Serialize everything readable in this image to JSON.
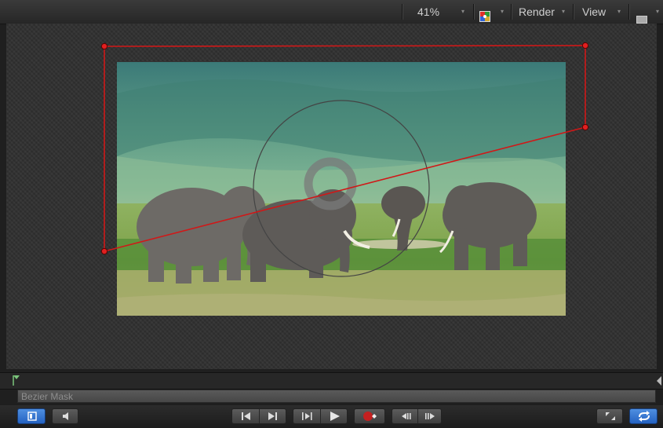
{
  "toolbar": {
    "zoom_level": "41%",
    "render_label": "Render",
    "view_label": "View",
    "dropdown_arrow": "▾",
    "icons": [
      "color-channel-icon",
      "layout-icon"
    ]
  },
  "canvas": {
    "image_subject": "elephants-on-savanna",
    "mask_color": "#d01818",
    "onscreen_controls": [
      "bezier-mask-handles",
      "center-target-ring"
    ]
  },
  "timeline": {
    "playhead_icon": "playhead-marker-icon",
    "end_marker_icon": "out-point-icon",
    "track_label": "Bezier Mask"
  },
  "transport": {
    "left_icons": [
      "show-timing-pane-icon",
      "audio-speaker-icon"
    ],
    "center_icons": [
      "go-to-start-icon",
      "go-to-end-icon",
      "step-forward-icon",
      "play-icon",
      "record-icon",
      "previous-frame-icon",
      "next-frame-icon"
    ],
    "right_icons": [
      "fullscreen-icon",
      "loop-playback-icon"
    ]
  },
  "colors": {
    "accent_blue": "#2f74d6",
    "mask_red": "#d01818",
    "record_red": "#c42020"
  }
}
